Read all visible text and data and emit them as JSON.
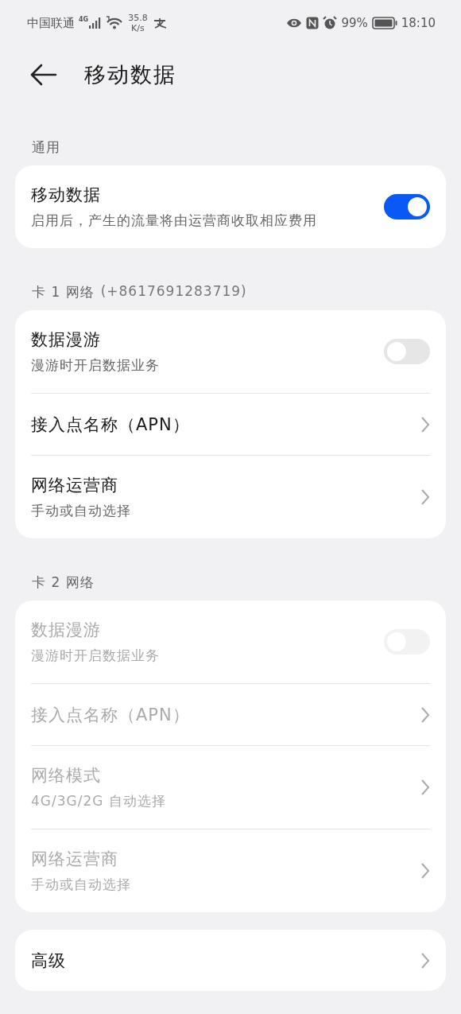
{
  "status_bar": {
    "carrier": "中国联通",
    "network": "4G",
    "speed_value": "35.8",
    "speed_unit": "K/s",
    "battery": "99%",
    "time": "18:10"
  },
  "header": {
    "title": "移动数据"
  },
  "sections": [
    {
      "label": "通用",
      "items": [
        {
          "kind": "toggle",
          "title": "移动数据",
          "subtitle": "启用后，产生的流量将由运营商收取相应费用",
          "on": true,
          "disabled": false
        }
      ]
    },
    {
      "label": "卡 1 网络",
      "note": "(+8617691283719)",
      "items": [
        {
          "kind": "toggle",
          "title": "数据漫游",
          "subtitle": "漫游时开启数据业务",
          "on": false,
          "disabled": false
        },
        {
          "kind": "link",
          "title": "接入点名称（APN）",
          "disabled": false
        },
        {
          "kind": "link",
          "title": "网络运营商",
          "subtitle": "手动或自动选择",
          "disabled": false
        }
      ]
    },
    {
      "label": "卡 2 网络",
      "items": [
        {
          "kind": "toggle",
          "title": "数据漫游",
          "subtitle": "漫游时开启数据业务",
          "on": false,
          "disabled": true
        },
        {
          "kind": "link",
          "title": "接入点名称（APN）",
          "disabled": true
        },
        {
          "kind": "link",
          "title": "网络模式",
          "subtitle": "4G/3G/2G 自动选择",
          "disabled": true
        },
        {
          "kind": "link",
          "title": "网络运营商",
          "subtitle": "手动或自动选择",
          "disabled": true
        }
      ]
    },
    {
      "items": [
        {
          "kind": "link",
          "title": "高级",
          "disabled": false
        }
      ]
    }
  ]
}
